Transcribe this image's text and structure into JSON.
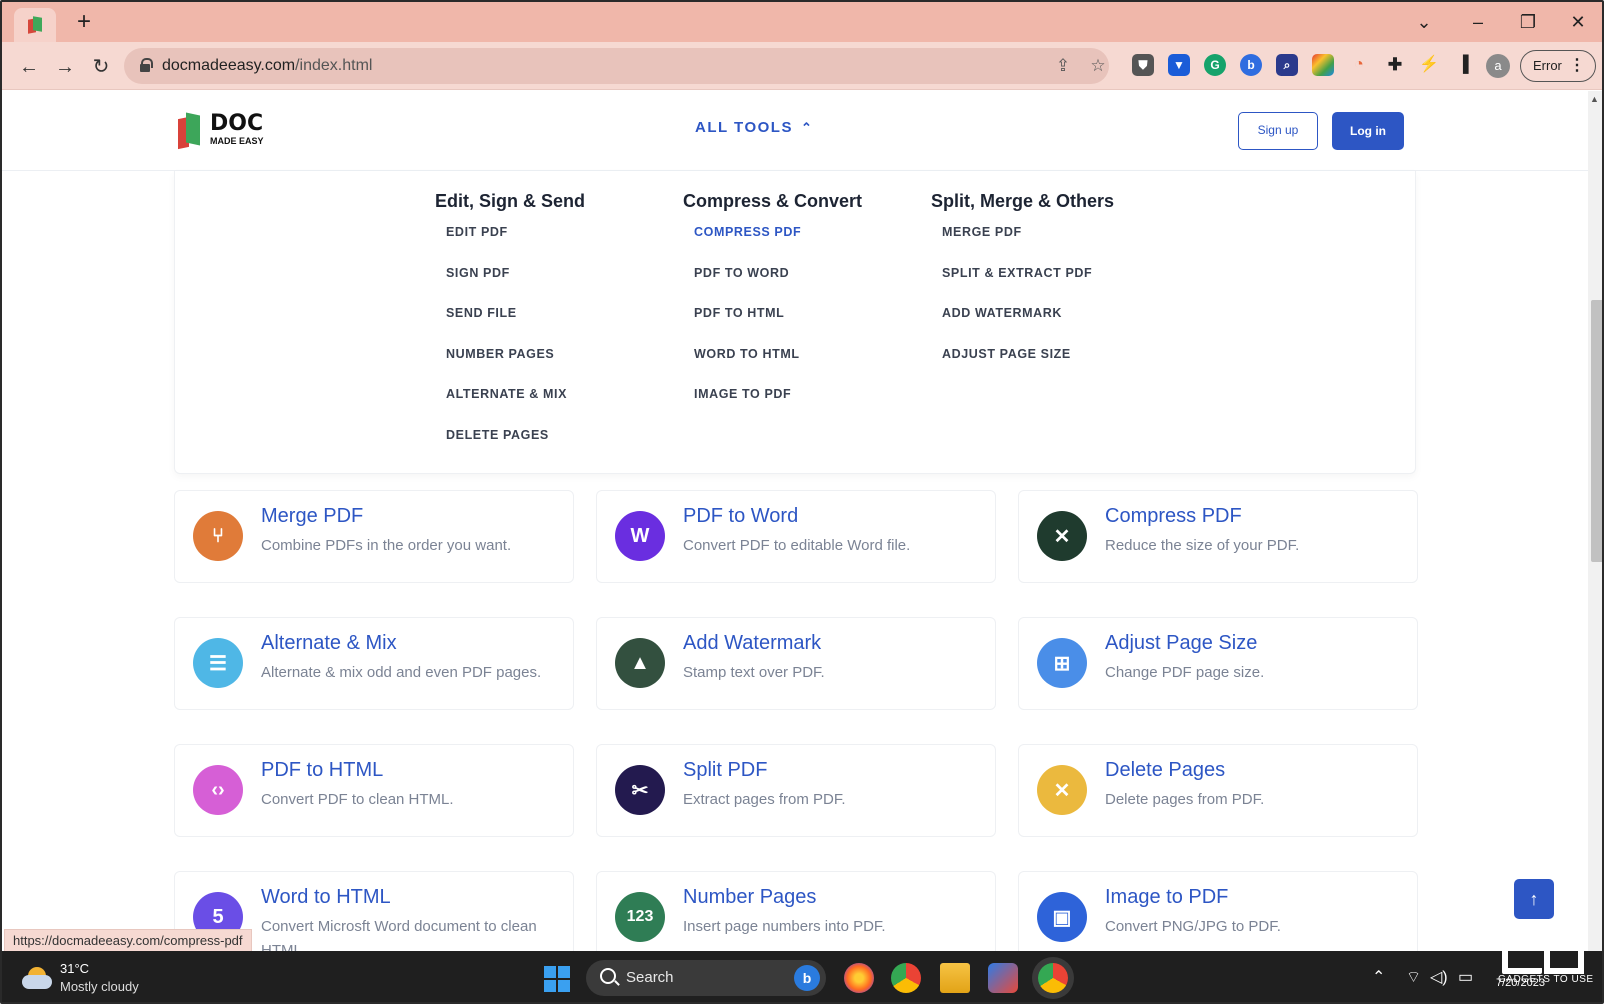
{
  "browser": {
    "url_host": "docmadeeasy.com",
    "url_path": "/index.html",
    "profile_initial": "a",
    "error_label": "Error",
    "status_url": "https://docmadeeasy.com/compress-pdf"
  },
  "header": {
    "logo_doc": "DOC",
    "logo_made_easy": "MADE EASY",
    "all_tools": "ALL TOOLS",
    "signup": "Sign up",
    "login": "Log in"
  },
  "menu": {
    "col1": {
      "title": "Edit, Sign & Send",
      "items": [
        "EDIT PDF",
        "SIGN PDF",
        "SEND FILE",
        "NUMBER PAGES",
        "ALTERNATE & MIX",
        "DELETE PAGES"
      ]
    },
    "col2": {
      "title": "Compress & Convert",
      "items": [
        "COMPRESS PDF",
        "PDF TO WORD",
        "PDF TO HTML",
        "WORD TO HTML",
        "IMAGE TO PDF"
      ]
    },
    "col3": {
      "title": "Split, Merge & Others",
      "items": [
        "MERGE PDF",
        "SPLIT & EXTRACT PDF",
        "ADD WATERMARK",
        "ADJUST PAGE SIZE"
      ]
    }
  },
  "cards": [
    {
      "title": "Merge PDF",
      "desc": "Combine PDFs in the order you want.",
      "color": "#e07b39",
      "glyph": "⑂"
    },
    {
      "title": "PDF to Word",
      "desc": "Convert PDF to editable Word file.",
      "color": "#6a2ee0",
      "glyph": "W"
    },
    {
      "title": "Compress PDF",
      "desc": "Reduce the size of your PDF.",
      "color": "#1f3b2e",
      "glyph": "✕"
    },
    {
      "title": "Alternate & Mix",
      "desc": "Alternate & mix odd and even PDF pages.",
      "color": "#4fb7e6",
      "glyph": "☰"
    },
    {
      "title": "Add Watermark",
      "desc": "Stamp text over PDF.",
      "color": "#33503f",
      "glyph": "▲"
    },
    {
      "title": "Adjust Page Size",
      "desc": "Change PDF page size.",
      "color": "#4a8ee8",
      "glyph": "⊞"
    },
    {
      "title": "PDF to HTML",
      "desc": "Convert PDF to clean HTML.",
      "color": "#d65fd6",
      "glyph": "‹›"
    },
    {
      "title": "Split PDF",
      "desc": "Extract pages from PDF.",
      "color": "#231a4f",
      "glyph": "✂"
    },
    {
      "title": "Delete Pages",
      "desc": "Delete pages from PDF.",
      "color": "#ebb93e",
      "glyph": "✕"
    },
    {
      "title": "Word to HTML",
      "desc": "Convert Microsft Word document to clean HTML.",
      "color": "#6a4ee6",
      "glyph": "5"
    },
    {
      "title": "Number Pages",
      "desc": "Insert page numbers into PDF.",
      "color": "#2f7d55",
      "glyph": "123"
    },
    {
      "title": "Image to PDF",
      "desc": "Convert PNG/JPG to PDF.",
      "color": "#2e63d9",
      "glyph": "▣"
    }
  ],
  "taskbar": {
    "temp": "31°C",
    "condition": "Mostly cloudy",
    "search": "Search",
    "clock": "7/20/2023"
  },
  "watermark": {
    "text": "GADGETS TO USE"
  }
}
